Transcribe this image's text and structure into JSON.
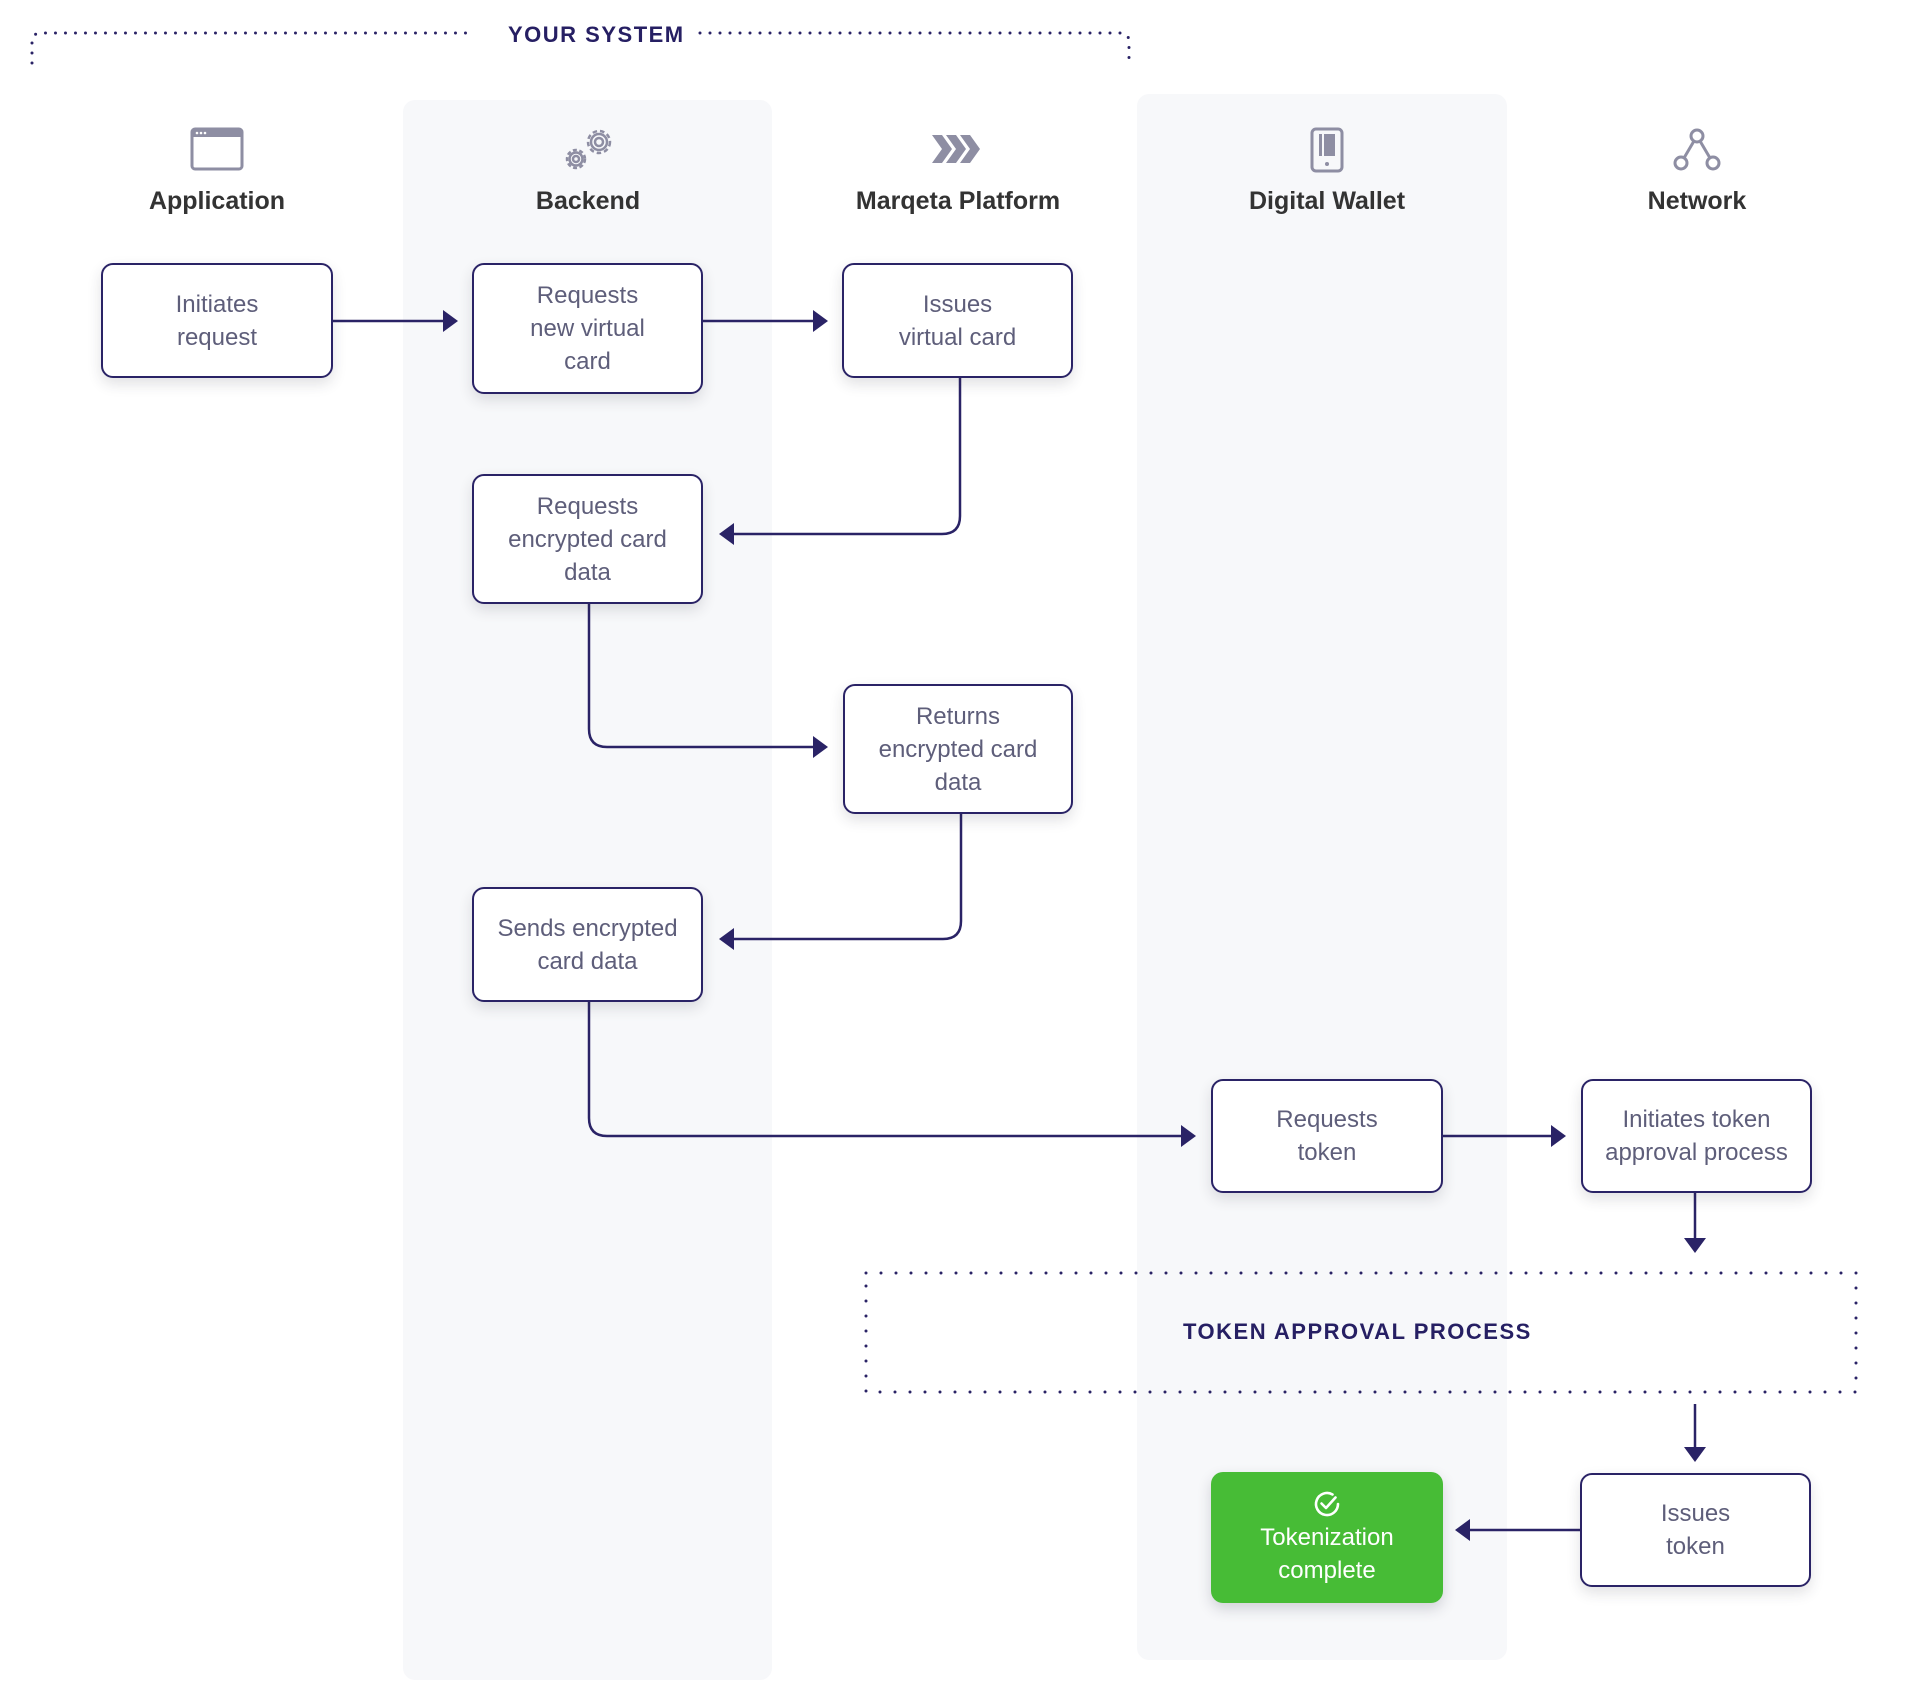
{
  "diagram": {
    "type": "swimlane-flowchart",
    "system_group": {
      "label": "YOUR SYSTEM",
      "spans_columns": [
        "application",
        "backend",
        "marqeta"
      ]
    },
    "columns": [
      {
        "id": "application",
        "label": "Application",
        "icon": "browser-window-icon",
        "shaded": false
      },
      {
        "id": "backend",
        "label": "Backend",
        "icon": "gears-icon",
        "shaded": true
      },
      {
        "id": "marqeta",
        "label": "Marqeta Platform",
        "icon": "chevrons-icon",
        "shaded": false
      },
      {
        "id": "wallet",
        "label": "Digital Wallet",
        "icon": "mobile-phone-icon",
        "shaded": true
      },
      {
        "id": "network",
        "label": "Network",
        "icon": "network-nodes-icon",
        "shaded": false
      }
    ],
    "steps": [
      {
        "id": "s1",
        "column": "application",
        "text": "Initiates\nrequest"
      },
      {
        "id": "s2",
        "column": "backend",
        "text": "Requests\nnew virtual\ncard"
      },
      {
        "id": "s3",
        "column": "marqeta",
        "text": "Issues\nvirtual card"
      },
      {
        "id": "s4",
        "column": "backend",
        "text": "Requests\nencrypted card\ndata"
      },
      {
        "id": "s5",
        "column": "marqeta",
        "text": "Returns\nencrypted card\ndata"
      },
      {
        "id": "s6",
        "column": "backend",
        "text": "Sends encrypted\ncard data"
      },
      {
        "id": "s7",
        "column": "wallet",
        "text": "Requests\ntoken"
      },
      {
        "id": "s8",
        "column": "network",
        "text": "Initiates token\napproval process"
      },
      {
        "id": "s9",
        "column": "network",
        "text": "Issues\ntoken"
      },
      {
        "id": "s10",
        "column": "wallet",
        "text": "Tokenization\ncomplete",
        "status": "success",
        "icon": "check-circle-icon"
      }
    ],
    "process_group": {
      "label": "TOKEN APPROVAL PROCESS"
    },
    "edges": [
      {
        "from": "s1",
        "to": "s2"
      },
      {
        "from": "s2",
        "to": "s3"
      },
      {
        "from": "s3",
        "to": "s4"
      },
      {
        "from": "s4",
        "to": "s5"
      },
      {
        "from": "s5",
        "to": "s6"
      },
      {
        "from": "s6",
        "to": "s7"
      },
      {
        "from": "s7",
        "to": "s8"
      },
      {
        "from": "s8",
        "to": "token-approval-process"
      },
      {
        "from": "token-approval-process",
        "to": "s9"
      },
      {
        "from": "s9",
        "to": "s10"
      }
    ]
  },
  "colors": {
    "line": "#2a2366",
    "lane_background": "#f7f8fa",
    "success": "#47bc36",
    "icon": "#8e8ea3",
    "heading_text": "#333333",
    "box_text": "#5e5e7a",
    "group_label": "#261f63"
  }
}
